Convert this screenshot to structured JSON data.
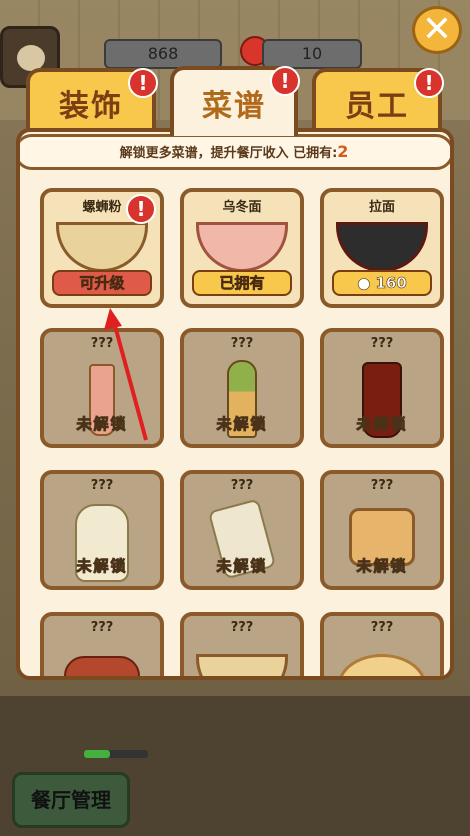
{
  "hud": {
    "coins": "868",
    "tomatoes": "10"
  },
  "tabs": [
    {
      "label": "装饰",
      "badge": "!"
    },
    {
      "label": "菜谱",
      "badge": "!"
    },
    {
      "label": "员工",
      "badge": "!"
    }
  ],
  "info": {
    "text": "解锁更多菜谱，提升餐厅收入  已拥有:",
    "owned": "2"
  },
  "recipes": [
    {
      "name": "螺蛳粉",
      "button": "可升级",
      "state": "upgrade",
      "badge": "!"
    },
    {
      "name": "乌冬面",
      "button": "已拥有",
      "state": "owned"
    },
    {
      "name": "拉面",
      "button": "160",
      "state": "price"
    },
    {
      "name": "???",
      "button": "未解锁",
      "state": "locked"
    },
    {
      "name": "???",
      "button": "未解锁",
      "state": "locked"
    },
    {
      "name": "???",
      "button": "未解锁",
      "state": "locked"
    },
    {
      "name": "???",
      "button": "未解锁",
      "state": "locked"
    },
    {
      "name": "???",
      "button": "未解锁",
      "state": "locked"
    },
    {
      "name": "???",
      "button": "未解锁",
      "state": "locked"
    },
    {
      "name": "???",
      "button": "",
      "state": "locked"
    },
    {
      "name": "???",
      "button": "",
      "state": "locked"
    },
    {
      "name": "???",
      "button": "",
      "state": "locked"
    }
  ],
  "bottom": {
    "restaurant_button": "餐厅管理"
  },
  "close": "✕",
  "colors": {
    "tab_yellow": "#f7c84c",
    "panel_bg": "#fbf1dc",
    "border_brown": "#7a4a21",
    "badge_red": "#d8332c",
    "upgrade_red": "#e05a4a"
  }
}
